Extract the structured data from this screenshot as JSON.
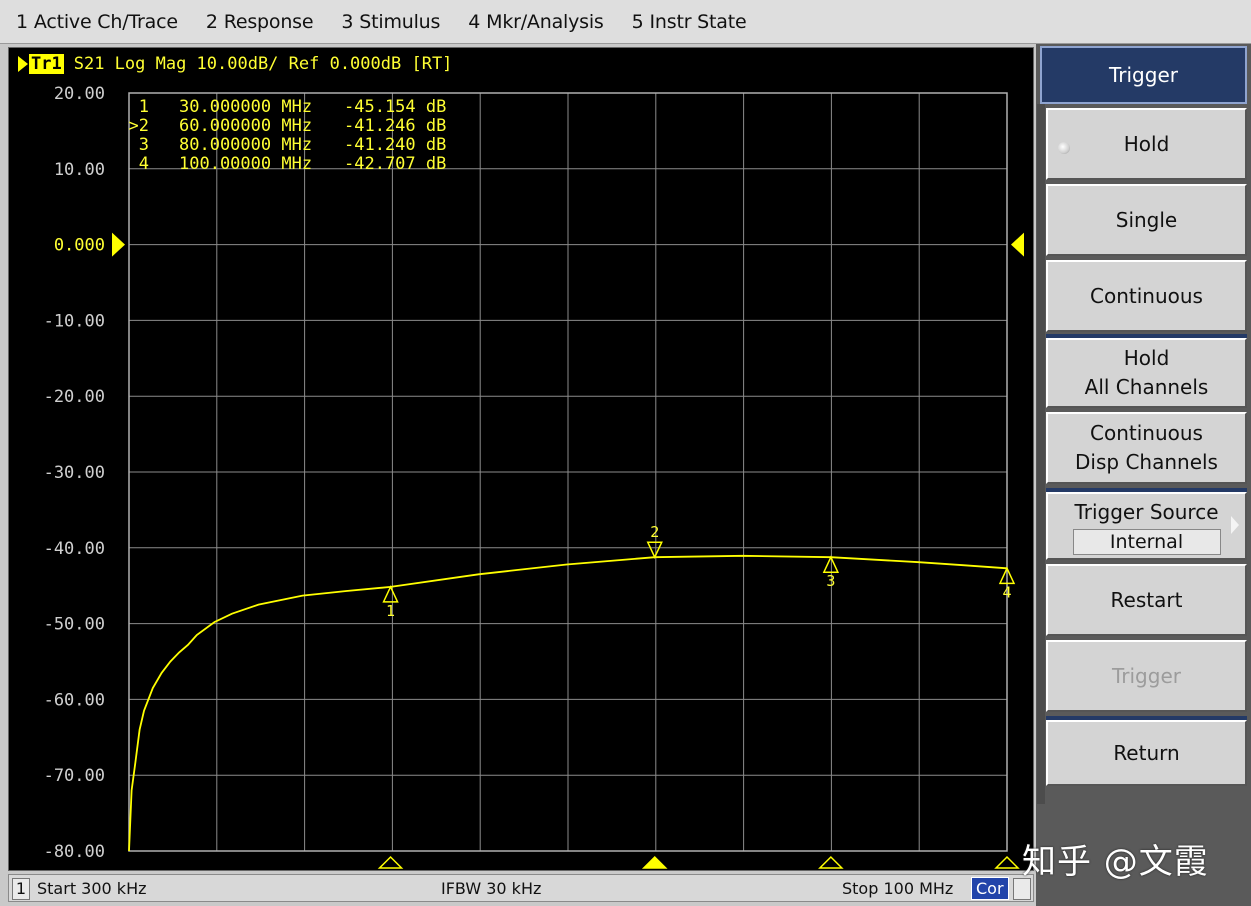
{
  "menu": [
    {
      "num": "1",
      "label": "Active Ch/Trace"
    },
    {
      "num": "2",
      "label": "Response"
    },
    {
      "num": "3",
      "label": "Stimulus"
    },
    {
      "num": "4",
      "label": "Mkr/Analysis"
    },
    {
      "num": "5",
      "label": "Instr State"
    }
  ],
  "trace": {
    "tag": "Tr1",
    "info": "S21 Log Mag 10.00dB/ Ref 0.000dB [RT]"
  },
  "marker_table": [
    {
      "id": "1",
      "prefix": " ",
      "freq": "30.000000 MHz",
      "value": "-45.154 dB"
    },
    {
      "id": "2",
      "prefix": ">",
      "freq": "60.000000 MHz",
      "value": "-41.246 dB"
    },
    {
      "id": "3",
      "prefix": " ",
      "freq": "80.000000 MHz",
      "value": "-41.240 dB"
    },
    {
      "id": "4",
      "prefix": " ",
      "freq": "100.00000 MHz",
      "value": "-42.707 dB"
    }
  ],
  "chart_data": {
    "type": "line",
    "xlabel": "",
    "ylabel": "",
    "xlim_mhz": [
      0.3,
      100
    ],
    "ylim_db": [
      -80,
      20
    ],
    "y_ticks": [
      "20.00",
      "10.00",
      "0.000",
      "-10.00",
      "-20.00",
      "-30.00",
      "-40.00",
      "-50.00",
      "-60.00",
      "-70.00",
      "-80.00"
    ],
    "reference_tick": "0.000",
    "grid": true,
    "series": [
      {
        "x": [
          0.3,
          0.6,
          1,
          1.5,
          2,
          3,
          4,
          5,
          6,
          7,
          8,
          10,
          12,
          15,
          20,
          25,
          30,
          40,
          50,
          60,
          70,
          80,
          90,
          95,
          100
        ],
        "y": [
          -80,
          -72,
          -68.5,
          -64,
          -61.5,
          -58.5,
          -56.5,
          -55,
          -53.8,
          -52.8,
          -51.5,
          -49.8,
          -48.7,
          -47.5,
          -46.3,
          -45.7,
          -45.154,
          -43.5,
          -42.2,
          -41.246,
          -41.05,
          -41.24,
          -41.9,
          -42.3,
          -42.707
        ]
      }
    ],
    "markers": [
      {
        "id": "1",
        "x": 30,
        "y": -45.154,
        "active": false
      },
      {
        "id": "2",
        "x": 60,
        "y": -41.246,
        "active": true
      },
      {
        "id": "3",
        "x": 80,
        "y": -41.24,
        "active": false
      },
      {
        "id": "4",
        "x": 100,
        "y": -42.707,
        "active": false
      }
    ],
    "colors": {
      "trace": "#ffff00",
      "grid": "#8c8c8c",
      "text": "#ffff33",
      "background": "#000000"
    }
  },
  "status": {
    "channel": "1",
    "start": "Start 300 kHz",
    "ifbw": "IFBW 30 kHz",
    "stop": "Stop 100 MHz",
    "cor": "Cor"
  },
  "softkeys": {
    "title": "Trigger",
    "hold": "Hold",
    "single": "Single",
    "continuous": "Continuous",
    "hold_all_line1": "Hold",
    "hold_all_line2": "All Channels",
    "cont_disp_line1": "Continuous",
    "cont_disp_line2": "Disp Channels",
    "trigger_source": "Trigger Source",
    "trigger_source_value": "Internal",
    "restart": "Restart",
    "trigger": "Trigger",
    "return": "Return"
  },
  "watermark": "知乎 @文霞"
}
